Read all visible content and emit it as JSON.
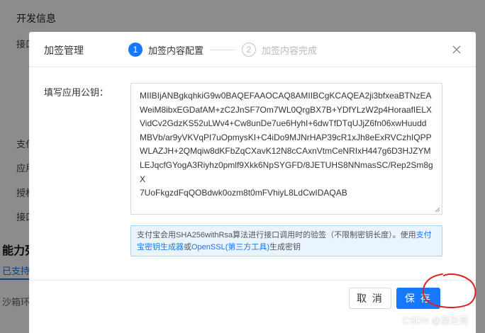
{
  "background": {
    "section_title": "开发信息",
    "labels": [
      "接口",
      "支付",
      "应用",
      "授权",
      "接口"
    ],
    "capability_title": "能力列",
    "active_tab": "已支持",
    "sandbox": "沙箱环"
  },
  "dialog": {
    "title": "加签管理",
    "steps": [
      {
        "number": "1",
        "label": "加签内容配置",
        "state": "active"
      },
      {
        "number": "2",
        "label": "加签内容完成",
        "state": "wait"
      }
    ],
    "field_label": "填写应用公钥：",
    "public_key_lines": [
      "MIIBIjANBgkqhkiG9w0BAQEFAAOCAQ8AMIIBCgKCAQEA2ji3bfxeaBTNzEA",
      "WeiM8ibxEGDafAM+zC2JnSF7Om7WL0QrgBX7B+YDfYLzW2p4HoraafIELX",
      "VidCv2GdzKS52uLWv4+Cw8unDe7ue6HyhI+6dwTfDTqUJjZ6fn06xwHuudd",
      "MBVb/ar9yVKVqPI7uOpmysKI+C4iDo9MJNrHAP39cR1xJh8eExRVCzhIQPP",
      "WLAZJH+2QMqiw8dKFbZqCXavK12N8cCAxnVtmCeNRIxH447g6D3HJZYM",
      "LEJqcfGYogA3Riyhz0pmlf9Xkk6NpSYGFD/8JETUHS8NNmasSC/Rep2Sm8gX",
      "7UoFkgzdFqQOBdwk0ozm8t0mFVhiyL8LdCwIDAQAB"
    ],
    "hint": {
      "text_before": "支付宝会用SHA256withRsa算法进行接口调用时的验签（不限制密钥长度）。使用",
      "link1": "支付宝密钥生成器",
      "text_mid": "或",
      "link2": "OpenSSL(第三方工具)",
      "text_after": "生成密钥"
    },
    "cancel_label": "取 消",
    "save_label": "保 存"
  },
  "watermark": "CSDN @梁云亮",
  "colors": {
    "primary": "#1677ff",
    "hint_background": "#e9f4fe",
    "hint_border": "#a8d2f7",
    "annotation": "#e02020"
  }
}
